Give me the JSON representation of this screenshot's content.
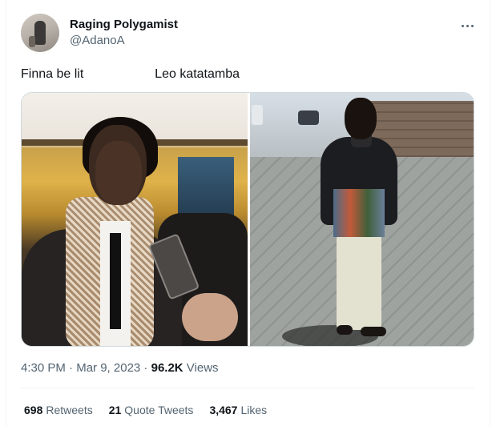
{
  "author": {
    "display_name": "Raging Polygamist",
    "handle": "@AdanoA"
  },
  "tweet": {
    "text": "Finna be lit                    Leo katatamba",
    "media": [
      {
        "alt": "left photo"
      },
      {
        "alt": "right photo"
      }
    ]
  },
  "meta": {
    "time": "4:30 PM",
    "separator1": " · ",
    "date": "Mar 9, 2023",
    "separator2": " · ",
    "views_count": "96.2K",
    "views_label": " Views"
  },
  "stats": {
    "retweets": {
      "count": "698",
      "label": "Retweets"
    },
    "quotes": {
      "count": "21",
      "label": "Quote Tweets"
    },
    "likes": {
      "count": "3,467",
      "label": "Likes"
    }
  },
  "icons": {
    "more": "more-horizontal-icon"
  },
  "colors": {
    "text_primary": "#0f1419",
    "text_secondary": "#536471",
    "border": "#eff3f4"
  }
}
